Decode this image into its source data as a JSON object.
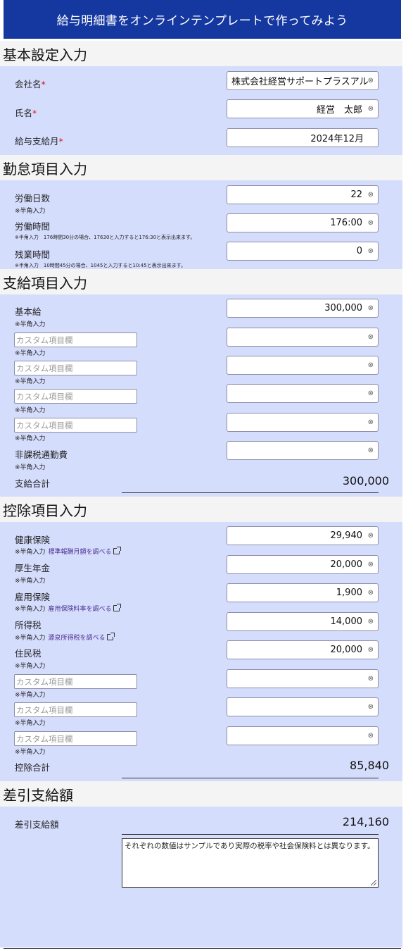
{
  "header": {
    "title": "給与明細書をオンラインテンプレートで作ってみよう"
  },
  "common": {
    "required_mark": "*",
    "hankaku_note": "※半角入力",
    "custom_placeholder": "カスタム項目欄",
    "clear_glyph": "⊗"
  },
  "basic": {
    "title": "基本設定入力",
    "company_label": "会社名",
    "company_value": "株式会社経営サポートプラスアル",
    "name_label": "氏名",
    "name_value": "経営　太郎",
    "month_label": "給与支給月",
    "month_value": "2024年12月"
  },
  "attendance": {
    "title": "勤怠項目入力",
    "days_label": "労働日数",
    "days_value": "22",
    "hours_label": "労働時間",
    "hours_value": "176:00",
    "hours_note": "※半角入力　176時間30分の場合、17630と入力すると176:30と表示出来ます。",
    "overtime_label": "残業時間",
    "overtime_value": "0",
    "overtime_note": "※半角入力　10時間45分の場合、1045と入力すると10:45と表示出来ます。"
  },
  "payment": {
    "title": "支給項目入力",
    "base_label": "基本給",
    "base_value": "300,000",
    "commute_label": "非課税通勤費",
    "commute_value": "",
    "total_label": "支給合計",
    "total_value": "300,000"
  },
  "deduction": {
    "title": "控除項目入力",
    "health_label": "健康保険",
    "health_value": "29,940",
    "health_link": "標準報酬月額を調べる",
    "pension_label": "厚生年金",
    "pension_value": "20,000",
    "employment_label": "雇用保険",
    "employment_value": "1,900",
    "employment_link": "雇用保険料率を調べる",
    "income_label": "所得税",
    "income_value": "14,000",
    "income_link": "源泉所得税を調べる",
    "resident_label": "住民税",
    "resident_value": "20,000",
    "total_label": "控除合計",
    "total_value": "85,840"
  },
  "net": {
    "title": "差引支給額",
    "label": "差引支給額",
    "value": "214,160",
    "remarks": "それぞれの数値はサンプルであり実際の税率や社会保険料とは異なります。"
  }
}
